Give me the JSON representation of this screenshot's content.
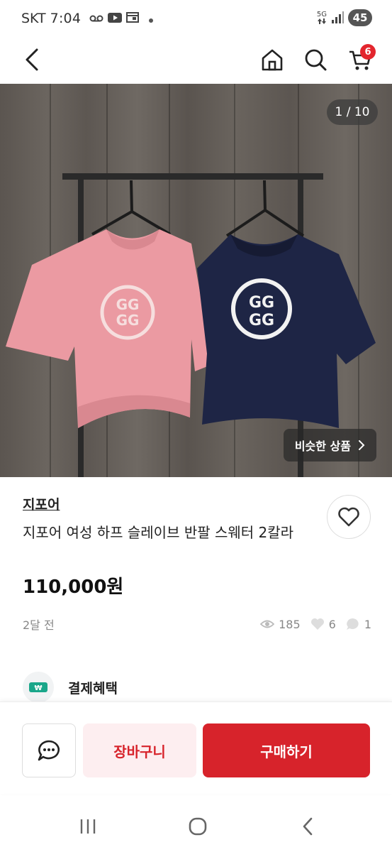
{
  "status_bar": {
    "carrier": "SKT",
    "time": "7:04",
    "network": "5G",
    "battery": "45"
  },
  "nav": {
    "cart_count": "6"
  },
  "gallery": {
    "counter": "1 / 10",
    "similar_label": "비슷한 상품"
  },
  "product": {
    "brand": "지포어",
    "title": "지포어 여성 하프 슬레이브 반팔 스웨터 2칼라",
    "price": "110,000원",
    "posted": "2달 전",
    "views": "185",
    "likes": "6",
    "chats": "1"
  },
  "payment": {
    "label": "결제혜택",
    "icon_text": "₩"
  },
  "actions": {
    "cart_label": "장바구니",
    "buy_label": "구매하기"
  },
  "colors": {
    "accent": "#d7232b",
    "accent_light": "#fdeef0",
    "pay_green": "#1aa78a"
  }
}
